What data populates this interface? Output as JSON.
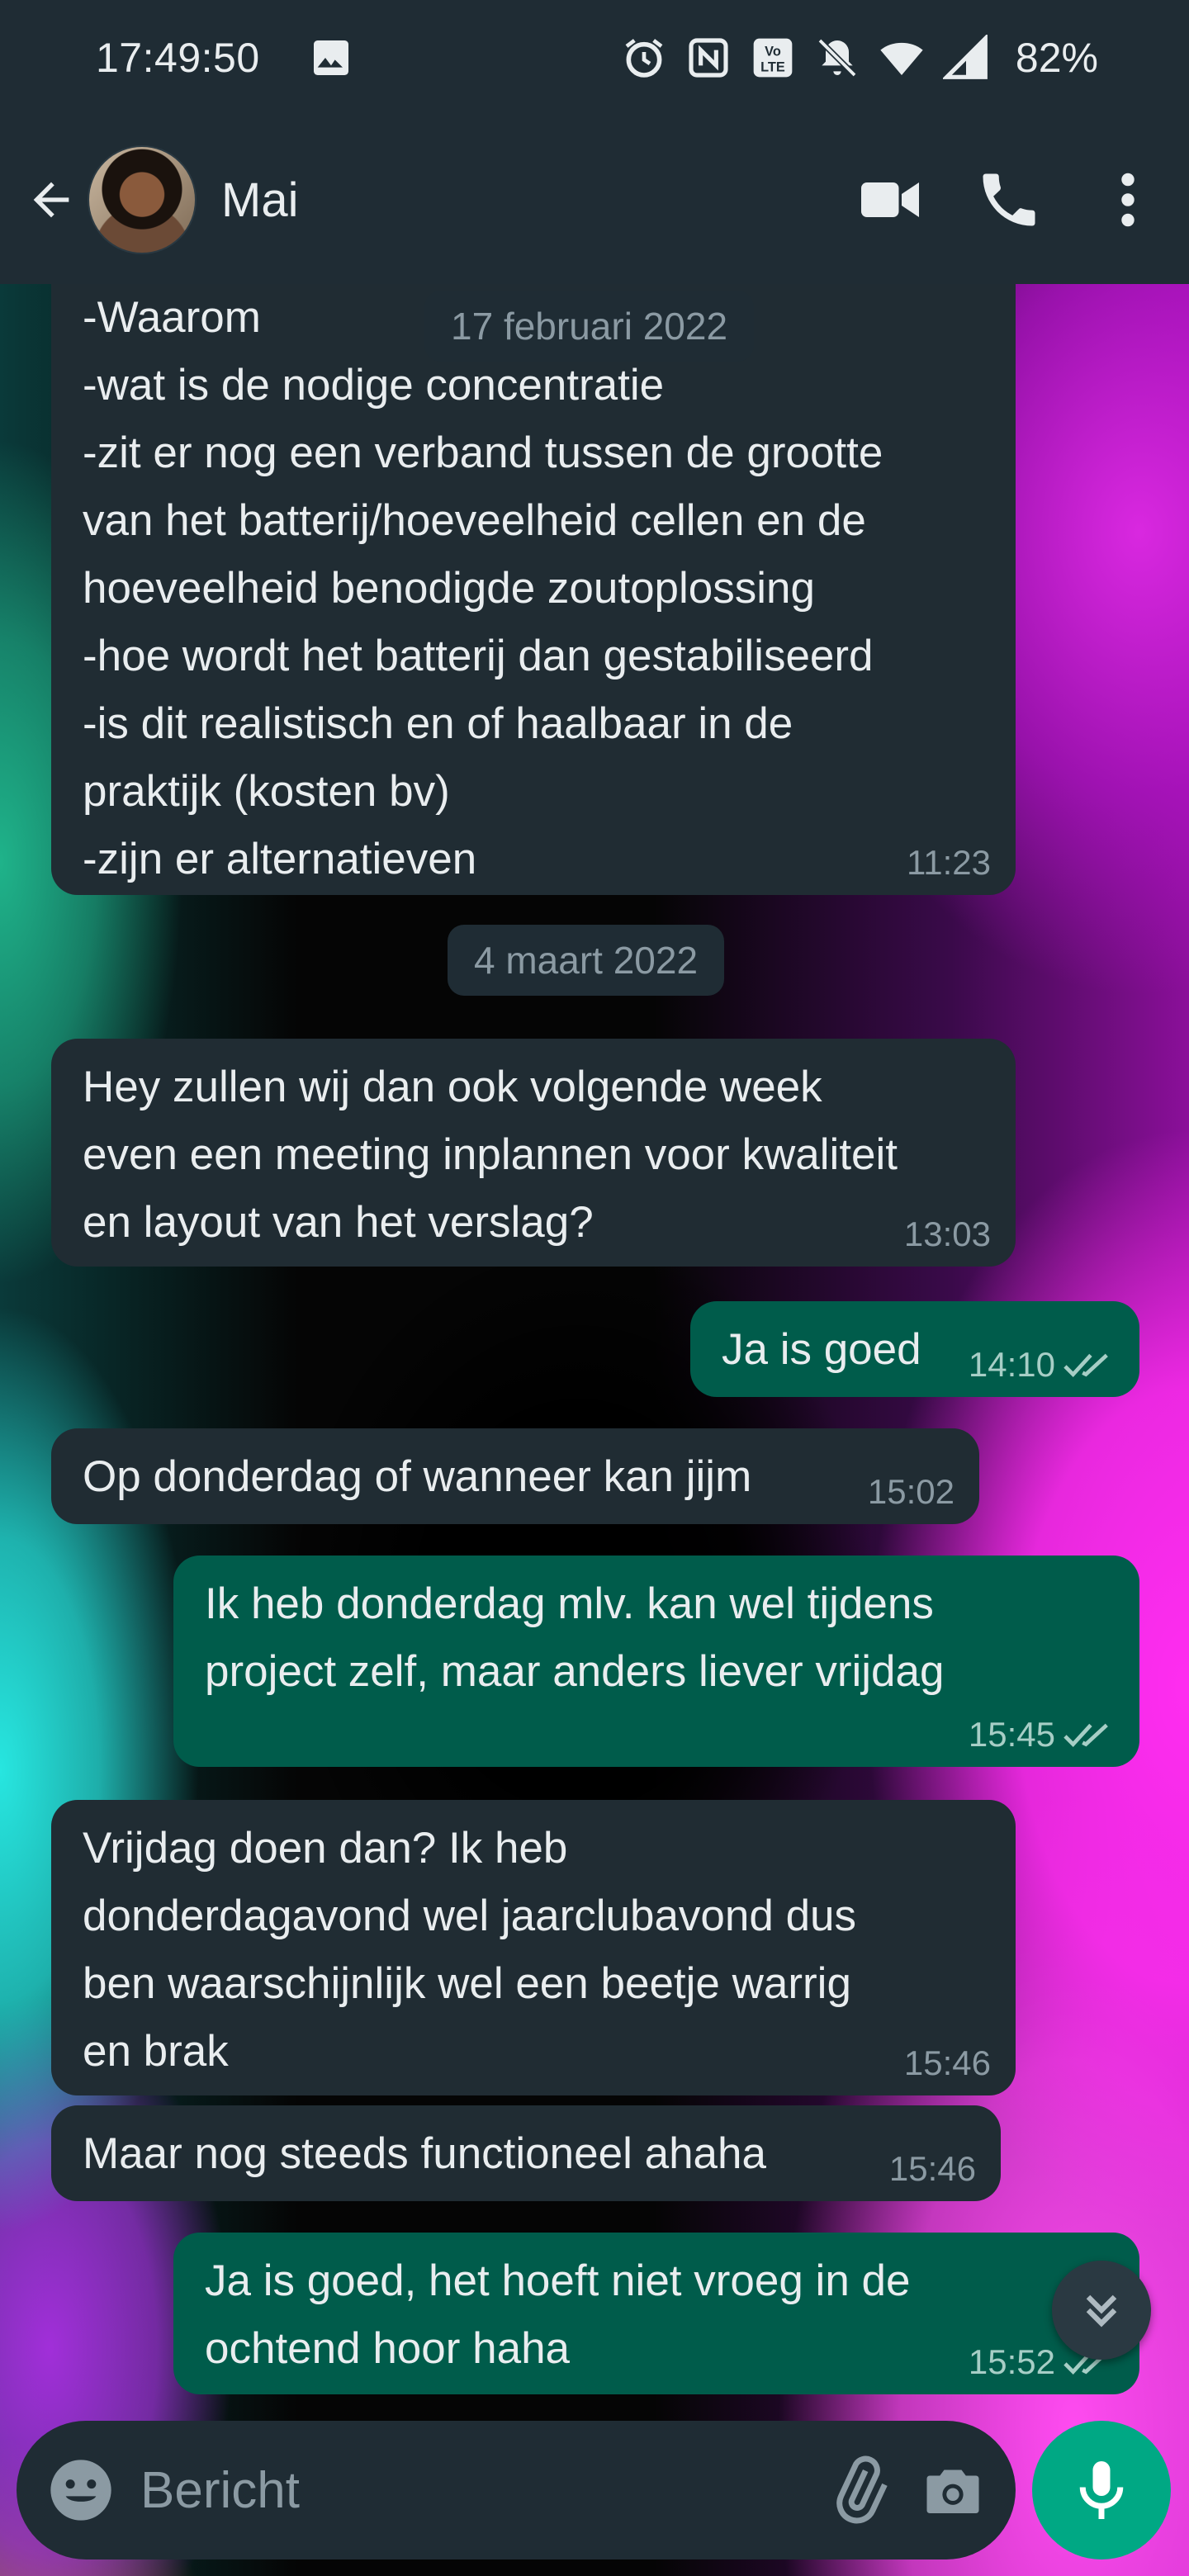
{
  "status_bar": {
    "time": "17:49:50",
    "battery": "82%",
    "icons": [
      "image-icon",
      "alarm-icon",
      "nfc-icon",
      "volte-icon",
      "mute-icon",
      "wifi-icon",
      "signal-icon",
      "battery-icon"
    ]
  },
  "header": {
    "contact_name": "Mai",
    "icons": [
      "back-arrow-icon",
      "avatar",
      "video-call-icon",
      "phone-icon",
      "more-vert-icon"
    ]
  },
  "messages": [
    {
      "direction": "in",
      "lines": [
        "-Waarom",
        "-wat  is de nodige concentratie",
        "-zit er nog een verband tussen de grootte",
        "van het batterij/hoeveelheid cellen en de",
        "hoeveelheid benodigde zoutoplossing",
        "-hoe wordt het batterij dan gestabiliseerd",
        "-is dit realistisch en of haalbaar in de",
        "praktijk (kosten bv)",
        "-zijn er alternatieven"
      ],
      "time": "11:23"
    },
    {
      "direction": "date",
      "text": "4 maart 2022"
    },
    {
      "direction": "in",
      "lines": [
        "Hey zullen wij dan ook volgende week",
        "even een meeting inplannen voor kwaliteit",
        "en layout van het verslag?"
      ],
      "time": "13:03"
    },
    {
      "direction": "out",
      "lines": [
        "Ja is goed"
      ],
      "time": "14:10",
      "read": true
    },
    {
      "direction": "in",
      "lines": [
        "Op donderdag of wanneer kan jijm"
      ],
      "time": "15:02"
    },
    {
      "direction": "out",
      "lines": [
        "Ik heb donderdag mlv. kan wel tijdens",
        "project zelf, maar anders liever vrijdag"
      ],
      "time": "15:45",
      "read": true
    },
    {
      "direction": "in",
      "lines": [
        "Vrijdag doen dan? Ik heb",
        "donderdagavond wel jaarclubavond dus",
        "ben waarschijnlijk wel een beetje warrig",
        "en brak"
      ],
      "time": "15:46"
    },
    {
      "direction": "in",
      "lines": [
        "Maar nog steeds functioneel ahaha"
      ],
      "time": "15:46"
    },
    {
      "direction": "out",
      "lines": [
        "Ja is goed, het hoeft niet vroeg in de",
        "ochtend hoor haha"
      ],
      "time": "15:52",
      "read": true
    }
  ],
  "floating_date": "17 februari 2022",
  "input": {
    "placeholder": "Bericht",
    "icons": [
      "emoji-icon",
      "attach-icon",
      "camera-icon",
      "mic-icon"
    ]
  },
  "colors": {
    "bubble_in": "#202c33",
    "bubble_out": "#005c4b",
    "accent": "#00a884",
    "header": "#1f2c34"
  }
}
